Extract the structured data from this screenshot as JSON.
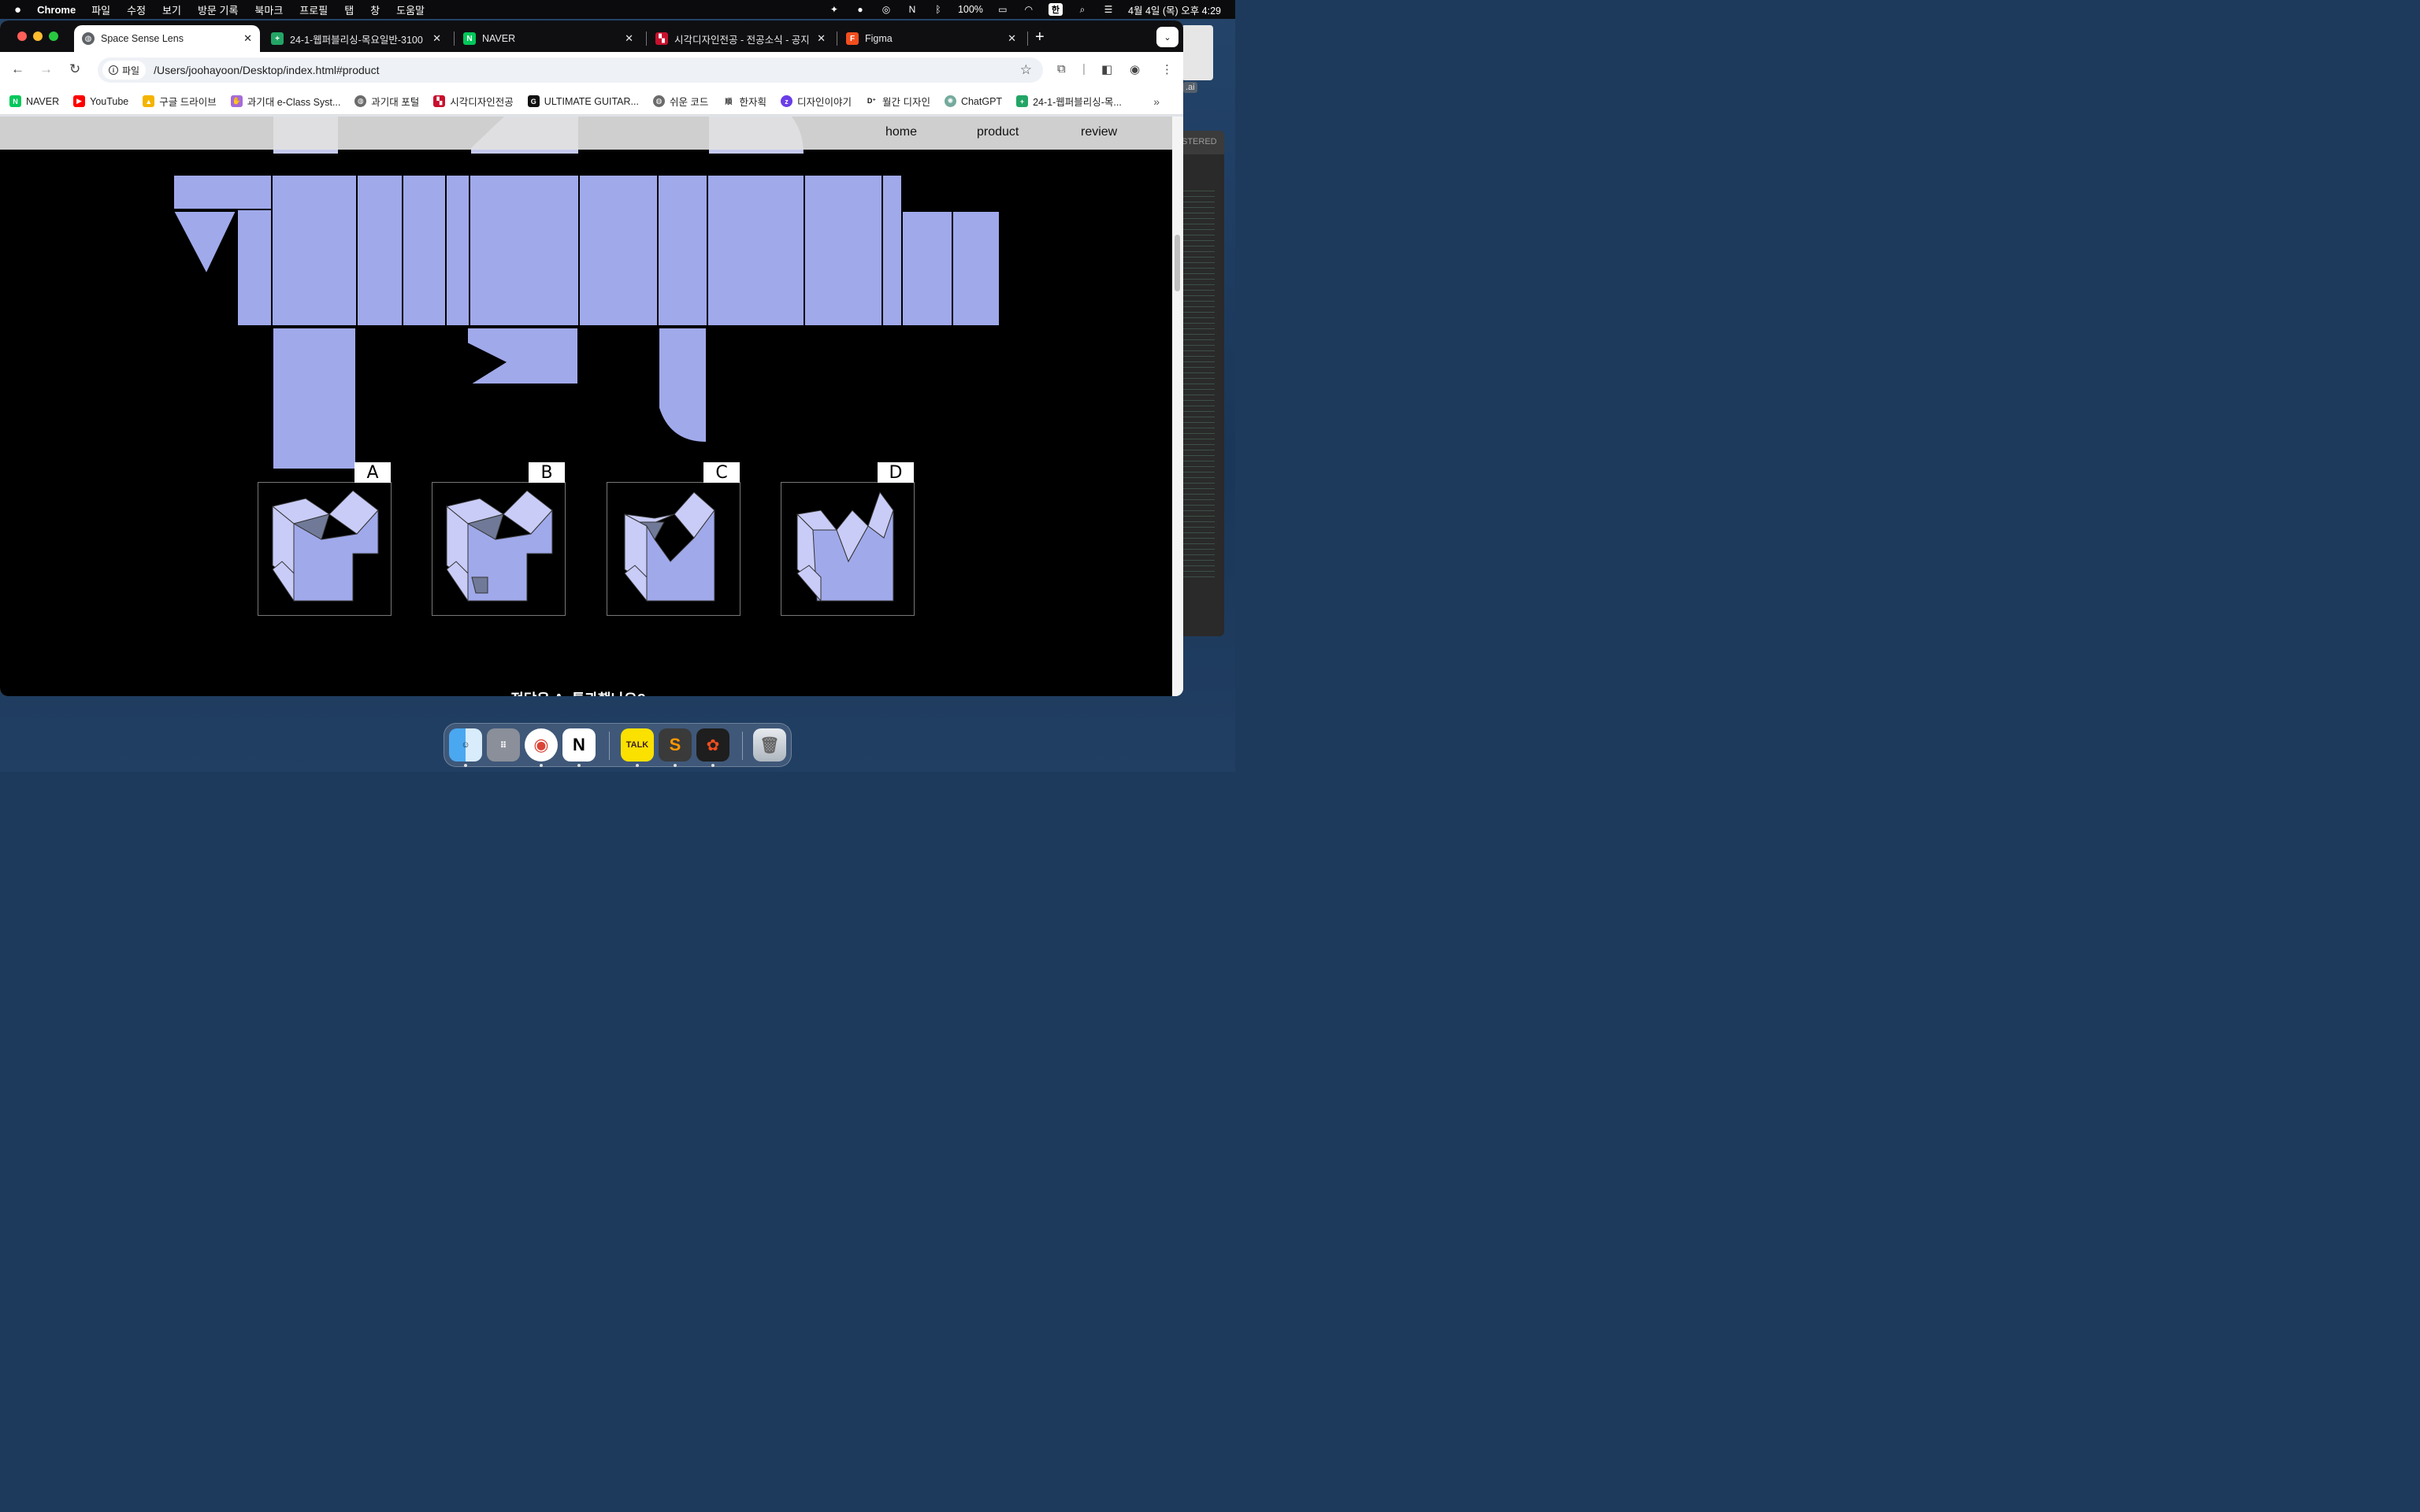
{
  "menubar": {
    "app_name": "Chrome",
    "menus": [
      "파일",
      "수정",
      "보기",
      "방문 기록",
      "북마크",
      "프로필",
      "탭",
      "창",
      "도움말"
    ],
    "battery": "100%",
    "ime": "한",
    "clock": "4월 4일 (목) 오후 4:29"
  },
  "tabs": [
    {
      "title": "Space Sense Lens",
      "icon": "globe-icon",
      "color": "#5f6368",
      "active": true
    },
    {
      "title": "24-1-웹퍼블리싱-목요일반-3100",
      "icon": "sheets-icon",
      "color": "#23a566",
      "active": false
    },
    {
      "title": "NAVER",
      "icon": "naver-icon",
      "color": "#03c75a",
      "active": false
    },
    {
      "title": "시각디자인전공 - 전공소식 - 공지사",
      "icon": "school-icon",
      "color": "#c8102e",
      "active": false
    },
    {
      "title": "Figma",
      "icon": "figma-icon",
      "color": "#f24e1e",
      "active": false
    }
  ],
  "omnibox": {
    "chip": "파일",
    "url": "/Users/joohayoon/Desktop/index.html#product"
  },
  "bookmarks": [
    {
      "label": "NAVER",
      "icon": "naver-icon",
      "color": "#03c75a"
    },
    {
      "label": "YouTube",
      "icon": "youtube-icon",
      "color": "#ff0000"
    },
    {
      "label": "구글 드라이브",
      "icon": "drive-icon",
      "color": "#f4b400"
    },
    {
      "label": "과기대 e-Class Syst...",
      "icon": "eclass-icon",
      "color": "#a66bd8"
    },
    {
      "label": "과기대 포털",
      "icon": "globe-icon",
      "color": "#6b6b6b"
    },
    {
      "label": "시각디자인전공",
      "icon": "school-icon",
      "color": "#c8102e"
    },
    {
      "label": "ULTIMATE GUITAR...",
      "icon": "guitar-icon",
      "color": "#111111"
    },
    {
      "label": "쉬운 코드",
      "icon": "globe-icon",
      "color": "#6b6b6b"
    },
    {
      "label": "한자획",
      "icon": "hanja-icon",
      "color": "#333333"
    },
    {
      "label": "디자인이야기",
      "icon": "design-icon",
      "color": "#6a3de8"
    },
    {
      "label": "월간 디자인",
      "icon": "d-plus-icon",
      "color": "#111111"
    },
    {
      "label": "ChatGPT",
      "icon": "chatgpt-icon",
      "color": "#74aa9c"
    },
    {
      "label": "24-1-웹퍼블리싱-목...",
      "icon": "sheets-icon",
      "color": "#23a566"
    }
  ],
  "nav": {
    "home": "home",
    "product": "product",
    "review": "review"
  },
  "options": [
    "A",
    "B",
    "C",
    "D"
  ],
  "question": "정답은 A. 통과했나요?",
  "colors": {
    "shape_fill": "#a0a9ea",
    "shape_light": "#c9ccf7",
    "shape_shadow": "#707a98",
    "page_bg": "#000000"
  },
  "dock": [
    {
      "name": "finder-icon",
      "label": "Finder"
    },
    {
      "name": "launchpad-icon",
      "label": "Launchpad"
    },
    {
      "name": "chrome-icon",
      "label": "Chrome"
    },
    {
      "name": "notion-icon",
      "label": "Notion"
    },
    {
      "name": "kakaotalk-icon",
      "label": "TALK"
    },
    {
      "name": "sublime-icon",
      "label": "S"
    },
    {
      "name": "figma-icon",
      "label": "Figma"
    },
    {
      "name": "trash-icon",
      "label": "Trash"
    }
  ],
  "bg_window": {
    "header": "STERED",
    "file_label": ".ai"
  }
}
